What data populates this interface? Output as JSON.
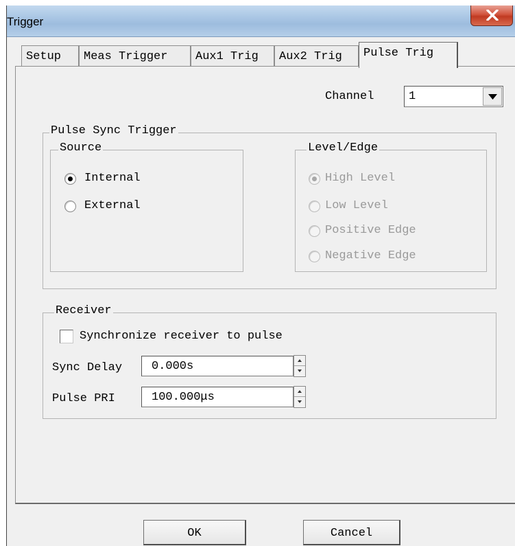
{
  "window": {
    "title": "Trigger"
  },
  "tabs": [
    {
      "label": "Setup"
    },
    {
      "label": "Meas Trigger"
    },
    {
      "label": "Aux1 Trig"
    },
    {
      "label": "Aux2 Trig"
    },
    {
      "label": "Pulse Trig",
      "active": true
    }
  ],
  "channel": {
    "label": "Channel",
    "value": "1"
  },
  "pulse_sync": {
    "title": "Pulse Sync Trigger",
    "source": {
      "title": "Source",
      "options": [
        {
          "label": "Internal",
          "selected": true
        },
        {
          "label": "External",
          "selected": false
        }
      ]
    },
    "level_edge": {
      "title": "Level/Edge",
      "enabled": false,
      "options": [
        {
          "label": "High Level",
          "selected": true
        },
        {
          "label": "Low Level",
          "selected": false
        },
        {
          "label": "Positive Edge",
          "selected": false
        },
        {
          "label": "Negative Edge",
          "selected": false
        }
      ]
    }
  },
  "receiver": {
    "title": "Receiver",
    "sync_checkbox": {
      "label": "Synchronize receiver to pulse",
      "checked": false
    },
    "sync_delay": {
      "label": "Sync Delay",
      "value": "0.000s"
    },
    "pulse_pri": {
      "label": "Pulse PRI",
      "value": "100.000μs"
    }
  },
  "buttons": {
    "ok": "OK",
    "cancel": "Cancel"
  },
  "colors": {
    "titlebar": "#a9c6e4",
    "close_button": "#d2543d",
    "dialog_bg": "#f0f0f0",
    "disabled_text": "#9a9a9a"
  },
  "icons": {
    "close": "close-icon",
    "dropdown": "chevron-down-icon",
    "spin_up": "spin-up-icon",
    "spin_down": "spin-down-icon"
  }
}
